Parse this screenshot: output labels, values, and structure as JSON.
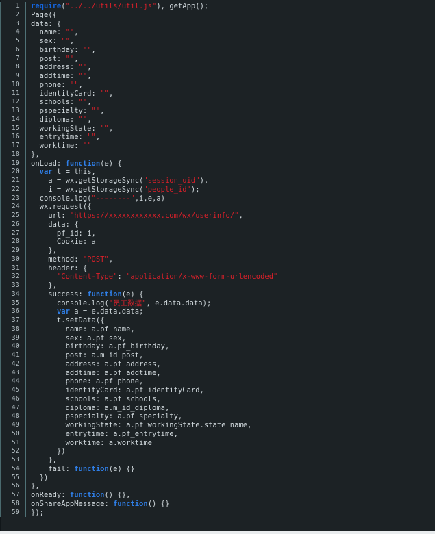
{
  "editor": {
    "language": "javascript",
    "total_lines": 59,
    "first_line_number": 1,
    "background_color": "#1c2225",
    "gutter_color": "#b3bec3",
    "default_text_color": "#ced6da",
    "string_color": "#d8202a",
    "keyword_color": "#1566e0",
    "gutter_rule_color": "#4f7277"
  },
  "lines": [
    {
      "n": 1,
      "tokens": [
        {
          "t": "require",
          "c": "kw"
        },
        {
          "t": "(",
          "c": "plain"
        },
        {
          "t": "\"../../utils/util.js\"",
          "c": "str"
        },
        {
          "t": "), getApp();",
          "c": "plain"
        }
      ]
    },
    {
      "n": 2,
      "tokens": [
        {
          "t": "Page({",
          "c": "plain"
        }
      ]
    },
    {
      "n": 3,
      "tokens": [
        {
          "t": "data: {",
          "c": "plain"
        }
      ]
    },
    {
      "n": 4,
      "tokens": [
        {
          "t": "  name: ",
          "c": "plain"
        },
        {
          "t": "\"\"",
          "c": "str"
        },
        {
          "t": ",",
          "c": "plain"
        }
      ]
    },
    {
      "n": 5,
      "tokens": [
        {
          "t": "  sex: ",
          "c": "plain"
        },
        {
          "t": "\"\"",
          "c": "str"
        },
        {
          "t": ",",
          "c": "plain"
        }
      ]
    },
    {
      "n": 6,
      "tokens": [
        {
          "t": "  birthday: ",
          "c": "plain"
        },
        {
          "t": "\"\"",
          "c": "str"
        },
        {
          "t": ",",
          "c": "plain"
        }
      ]
    },
    {
      "n": 7,
      "tokens": [
        {
          "t": "  post: ",
          "c": "plain"
        },
        {
          "t": "\"\"",
          "c": "str"
        },
        {
          "t": ",",
          "c": "plain"
        }
      ]
    },
    {
      "n": 8,
      "tokens": [
        {
          "t": "  address: ",
          "c": "plain"
        },
        {
          "t": "\"\"",
          "c": "str"
        },
        {
          "t": ",",
          "c": "plain"
        }
      ]
    },
    {
      "n": 9,
      "tokens": [
        {
          "t": "  addtime: ",
          "c": "plain"
        },
        {
          "t": "\"\"",
          "c": "str"
        },
        {
          "t": ",",
          "c": "plain"
        }
      ]
    },
    {
      "n": 10,
      "tokens": [
        {
          "t": "  phone: ",
          "c": "plain"
        },
        {
          "t": "\"\"",
          "c": "str"
        },
        {
          "t": ",",
          "c": "plain"
        }
      ]
    },
    {
      "n": 11,
      "tokens": [
        {
          "t": "  identityCard: ",
          "c": "plain"
        },
        {
          "t": "\"\"",
          "c": "str"
        },
        {
          "t": ",",
          "c": "plain"
        }
      ]
    },
    {
      "n": 12,
      "tokens": [
        {
          "t": "  schools: ",
          "c": "plain"
        },
        {
          "t": "\"\"",
          "c": "str"
        },
        {
          "t": ",",
          "c": "plain"
        }
      ]
    },
    {
      "n": 13,
      "tokens": [
        {
          "t": "  pspecialty: ",
          "c": "plain"
        },
        {
          "t": "\"\"",
          "c": "str"
        },
        {
          "t": ",",
          "c": "plain"
        }
      ]
    },
    {
      "n": 14,
      "tokens": [
        {
          "t": "  diploma: ",
          "c": "plain"
        },
        {
          "t": "\"\"",
          "c": "str"
        },
        {
          "t": ",",
          "c": "plain"
        }
      ]
    },
    {
      "n": 15,
      "tokens": [
        {
          "t": "  workingState: ",
          "c": "plain"
        },
        {
          "t": "\"\"",
          "c": "str"
        },
        {
          "t": ",",
          "c": "plain"
        }
      ]
    },
    {
      "n": 16,
      "tokens": [
        {
          "t": "  entrytime: ",
          "c": "plain"
        },
        {
          "t": "\"\"",
          "c": "str"
        },
        {
          "t": ",",
          "c": "plain"
        }
      ]
    },
    {
      "n": 17,
      "tokens": [
        {
          "t": "  worktime: ",
          "c": "plain"
        },
        {
          "t": "\"\"",
          "c": "str"
        }
      ]
    },
    {
      "n": 18,
      "tokens": [
        {
          "t": "},",
          "c": "plain"
        }
      ]
    },
    {
      "n": 19,
      "tokens": [
        {
          "t": "onLoad: ",
          "c": "plain"
        },
        {
          "t": "function",
          "c": "kw2"
        },
        {
          "t": "(e) {",
          "c": "plain"
        }
      ]
    },
    {
      "n": 20,
      "tokens": [
        {
          "t": "  ",
          "c": "plain"
        },
        {
          "t": "var",
          "c": "kw2"
        },
        {
          "t": " t = this,",
          "c": "plain"
        }
      ]
    },
    {
      "n": 21,
      "tokens": [
        {
          "t": "    a = wx.getStorageSync(",
          "c": "plain"
        },
        {
          "t": "\"session_uid\"",
          "c": "str"
        },
        {
          "t": "),",
          "c": "plain"
        }
      ]
    },
    {
      "n": 22,
      "tokens": [
        {
          "t": "    i = wx.getStorageSync(",
          "c": "plain"
        },
        {
          "t": "\"people_id\"",
          "c": "str"
        },
        {
          "t": ");",
          "c": "plain"
        }
      ]
    },
    {
      "n": 23,
      "tokens": [
        {
          "t": "  console.log(",
          "c": "plain"
        },
        {
          "t": "\"--------\"",
          "c": "str"
        },
        {
          "t": ",i,e,a)",
          "c": "plain"
        }
      ]
    },
    {
      "n": 24,
      "tokens": [
        {
          "t": "  wx.request({",
          "c": "plain"
        }
      ]
    },
    {
      "n": 25,
      "tokens": [
        {
          "t": "    url: ",
          "c": "plain"
        },
        {
          "t": "\"https://xxxxxxxxxxxx.com/wx/userinfo/\"",
          "c": "str"
        },
        {
          "t": ",",
          "c": "plain"
        }
      ]
    },
    {
      "n": 26,
      "tokens": [
        {
          "t": "    data: {",
          "c": "plain"
        }
      ]
    },
    {
      "n": 27,
      "tokens": [
        {
          "t": "      pf_id: i,",
          "c": "plain"
        }
      ]
    },
    {
      "n": 28,
      "tokens": [
        {
          "t": "      Cookie: a",
          "c": "plain"
        }
      ]
    },
    {
      "n": 29,
      "tokens": [
        {
          "t": "    },",
          "c": "plain"
        }
      ]
    },
    {
      "n": 30,
      "tokens": [
        {
          "t": "    method: ",
          "c": "plain"
        },
        {
          "t": "\"POST\"",
          "c": "str"
        },
        {
          "t": ",",
          "c": "plain"
        }
      ]
    },
    {
      "n": 31,
      "tokens": [
        {
          "t": "    header: {",
          "c": "plain"
        }
      ]
    },
    {
      "n": 32,
      "tokens": [
        {
          "t": "      ",
          "c": "plain"
        },
        {
          "t": "\"Content-Type\"",
          "c": "str"
        },
        {
          "t": ": ",
          "c": "plain"
        },
        {
          "t": "\"application/x-www-form-urlencoded\"",
          "c": "str"
        }
      ]
    },
    {
      "n": 33,
      "tokens": [
        {
          "t": "    },",
          "c": "plain"
        }
      ]
    },
    {
      "n": 34,
      "tokens": [
        {
          "t": "    success: ",
          "c": "plain"
        },
        {
          "t": "function",
          "c": "kw2"
        },
        {
          "t": "(e) {",
          "c": "plain"
        }
      ]
    },
    {
      "n": 35,
      "tokens": [
        {
          "t": "      console.log(",
          "c": "plain"
        },
        {
          "t": "\"员工数据\"",
          "c": "strcn"
        },
        {
          "t": ", e.data.data);",
          "c": "plain"
        }
      ]
    },
    {
      "n": 36,
      "tokens": [
        {
          "t": "      ",
          "c": "plain"
        },
        {
          "t": "var",
          "c": "kw2"
        },
        {
          "t": " a = e.data.data;",
          "c": "plain"
        }
      ]
    },
    {
      "n": 37,
      "tokens": [
        {
          "t": "      t.setData({",
          "c": "plain"
        }
      ]
    },
    {
      "n": 38,
      "tokens": [
        {
          "t": "        name: a.pf_name,",
          "c": "plain"
        }
      ]
    },
    {
      "n": 39,
      "tokens": [
        {
          "t": "        sex: a.pf_sex,",
          "c": "plain"
        }
      ]
    },
    {
      "n": 40,
      "tokens": [
        {
          "t": "        birthday: a.pf_birthday,",
          "c": "plain"
        }
      ]
    },
    {
      "n": 41,
      "tokens": [
        {
          "t": "        post: a.m_id_post,",
          "c": "plain"
        }
      ]
    },
    {
      "n": 42,
      "tokens": [
        {
          "t": "        address: a.pf_address,",
          "c": "plain"
        }
      ]
    },
    {
      "n": 43,
      "tokens": [
        {
          "t": "        addtime: a.pf_addtime,",
          "c": "plain"
        }
      ]
    },
    {
      "n": 44,
      "tokens": [
        {
          "t": "        phone: a.pf_phone,",
          "c": "plain"
        }
      ]
    },
    {
      "n": 45,
      "tokens": [
        {
          "t": "        identityCard: a.pf_identityCard,",
          "c": "plain"
        }
      ]
    },
    {
      "n": 46,
      "tokens": [
        {
          "t": "        schools: a.pf_schools,",
          "c": "plain"
        }
      ]
    },
    {
      "n": 47,
      "tokens": [
        {
          "t": "        diploma: a.m_id_diploma,",
          "c": "plain"
        }
      ]
    },
    {
      "n": 48,
      "tokens": [
        {
          "t": "        pspecialty: a.pf_specialty,",
          "c": "plain"
        }
      ]
    },
    {
      "n": 49,
      "tokens": [
        {
          "t": "        workingState: a.pf_workingState.state_name,",
          "c": "plain"
        }
      ]
    },
    {
      "n": 50,
      "tokens": [
        {
          "t": "        entrytime: a.pf_entrytime,",
          "c": "plain"
        }
      ]
    },
    {
      "n": 51,
      "tokens": [
        {
          "t": "        worktime: a.worktime",
          "c": "plain"
        }
      ]
    },
    {
      "n": 52,
      "tokens": [
        {
          "t": "      })",
          "c": "plain"
        }
      ]
    },
    {
      "n": 53,
      "tokens": [
        {
          "t": "    },",
          "c": "plain"
        }
      ]
    },
    {
      "n": 54,
      "tokens": [
        {
          "t": "    fail: ",
          "c": "plain"
        },
        {
          "t": "function",
          "c": "kw2"
        },
        {
          "t": "(e) {}",
          "c": "plain"
        }
      ]
    },
    {
      "n": 55,
      "tokens": [
        {
          "t": "  })",
          "c": "plain"
        }
      ]
    },
    {
      "n": 56,
      "tokens": [
        {
          "t": "},",
          "c": "plain"
        }
      ]
    },
    {
      "n": 57,
      "tokens": [
        {
          "t": "onReady: ",
          "c": "plain"
        },
        {
          "t": "function",
          "c": "kw2"
        },
        {
          "t": "() {},",
          "c": "plain"
        }
      ]
    },
    {
      "n": 58,
      "tokens": [
        {
          "t": "onShareAppMessage: ",
          "c": "plain"
        },
        {
          "t": "function",
          "c": "kw2"
        },
        {
          "t": "() {}",
          "c": "plain"
        }
      ]
    },
    {
      "n": 59,
      "tokens": [
        {
          "t": "});",
          "c": "plain"
        }
      ]
    }
  ]
}
